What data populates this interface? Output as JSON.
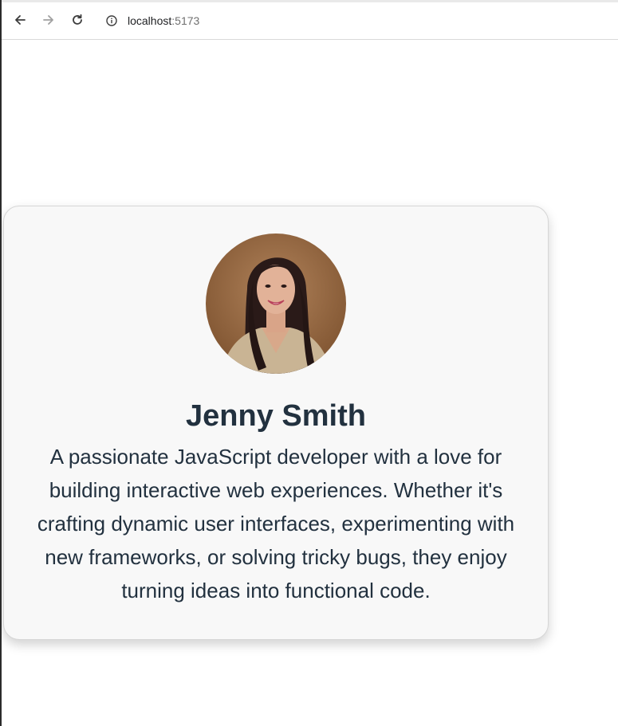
{
  "browser": {
    "url_host": "localhost",
    "url_port": ":5173"
  },
  "profile": {
    "name": "Jenny Smith",
    "bio": "A passionate JavaScript developer with a love for building interactive web experiences. Whether it's crafting dynamic user interfaces, experimenting with new frameworks, or solving tricky bugs, they enjoy turning ideas into functional code."
  },
  "colors": {
    "card_background": "#f8f8f8",
    "text": "#22313f",
    "page_background": "#ffffff"
  },
  "icons": {
    "back": "arrow-left-icon",
    "forward": "arrow-right-icon",
    "reload": "reload-icon",
    "site_info": "info-icon"
  }
}
